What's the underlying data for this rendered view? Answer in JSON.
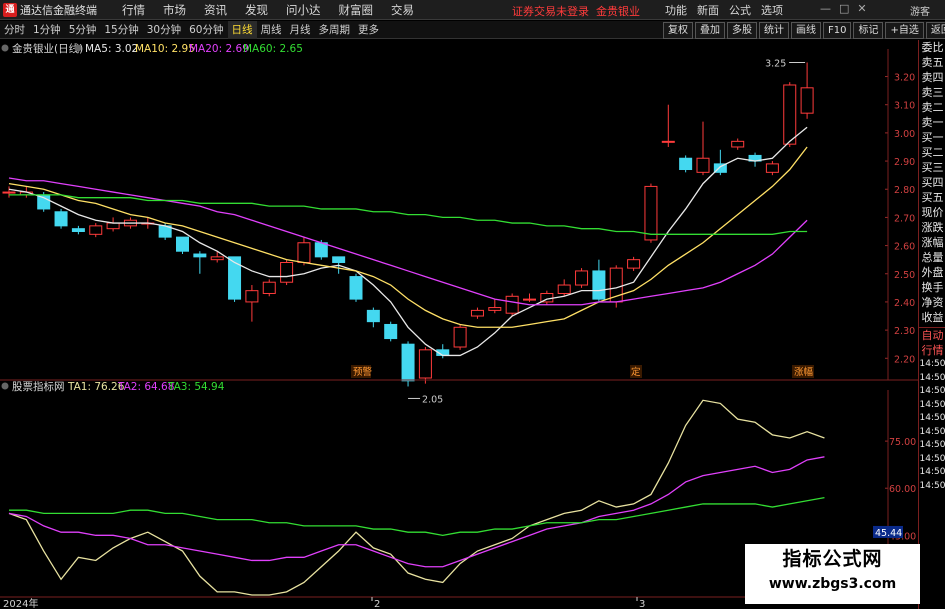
{
  "app": {
    "logo": "通",
    "title": "通达信金融终端",
    "menu": [
      "行情",
      "市场",
      "资讯",
      "发现",
      "问小达",
      "财富圈",
      "交易"
    ],
    "login_notice": "证券交易未登录",
    "login_stock": "金贵银业",
    "right_menu": [
      "功能",
      "新面",
      "公式",
      "选项"
    ],
    "guest": "游客"
  },
  "period_tabs": [
    {
      "label": "分时",
      "active": false
    },
    {
      "label": "1分钟",
      "active": false
    },
    {
      "label": "5分钟",
      "active": false
    },
    {
      "label": "15分钟",
      "active": false
    },
    {
      "label": "30分钟",
      "active": false
    },
    {
      "label": "60分钟",
      "active": false
    },
    {
      "label": "日线",
      "active": true
    },
    {
      "label": "周线",
      "active": false
    },
    {
      "label": "月线",
      "active": false
    },
    {
      "label": "多周期",
      "active": false
    },
    {
      "label": "更多",
      "active": false
    }
  ],
  "right_tools": [
    "复权",
    "叠加",
    "多股",
    "统计",
    "画线",
    "F10",
    "标记",
    "+自选",
    "返回"
  ],
  "price_panel": {
    "stock_label": "金贵银业(日线)",
    "indicators": [
      {
        "name": "MA5",
        "value": "3.02",
        "color": "#e8e8e8"
      },
      {
        "name": "MA10",
        "value": "2.95",
        "color": "#ffe066"
      },
      {
        "name": "MA20",
        "value": "2.69",
        "color": "#e040fb"
      },
      {
        "name": "MA60",
        "value": "2.65",
        "color": "#33dd33"
      }
    ],
    "y_ticks": [
      "3.20",
      "3.10",
      "3.00",
      "2.90",
      "2.80",
      "2.70",
      "2.60",
      "2.50",
      "2.40",
      "2.30",
      "2.20"
    ],
    "high_marker": "3.25",
    "low_marker": "2.05",
    "event_tags": [
      "预警",
      "定",
      "涨幅"
    ]
  },
  "indicator_panel": {
    "name": "股票指标网",
    "series": [
      {
        "name": "TA1",
        "value": "76.26",
        "color": "#e8e2a0"
      },
      {
        "name": "TA2",
        "value": "64.68",
        "color": "#e040fb"
      },
      {
        "name": "TA3",
        "value": "54.94",
        "color": "#33dd33"
      }
    ],
    "y_ticks": [
      "75.00",
      "60.00",
      "45.00",
      "30.00"
    ],
    "current_value": "45.44"
  },
  "x_axis": {
    "labels": [
      "2024年",
      "2",
      "3"
    ]
  },
  "right_panel": {
    "items": [
      "委比",
      "卖五",
      "卖四",
      "卖三",
      "卖二",
      "卖一",
      "买一",
      "买二",
      "买三",
      "买四",
      "买五",
      "现价",
      "涨跌",
      "涨幅",
      "总量",
      "外盘",
      "换手",
      "净资",
      "收益"
    ],
    "items2": [
      "自动",
      "行情"
    ],
    "times": [
      "14:50",
      "14:50",
      "14:50",
      "14:50",
      "14:50",
      "14:50",
      "14:50",
      "14:50",
      "14:50",
      "14:50"
    ]
  },
  "watermark": {
    "line1": "指标公式网",
    "line2": "www.zbgs3.com"
  },
  "chart_data": [
    {
      "type": "candlestick",
      "title": "金贵银业(日线)",
      "ylim": [
        2.13,
        3.28
      ],
      "y_ticks": [
        3.2,
        3.1,
        3.0,
        2.9,
        2.8,
        2.7,
        2.6,
        2.5,
        2.4,
        2.3,
        2.2
      ],
      "candles": [
        {
          "o": 2.79,
          "c": 2.79,
          "h": 2.81,
          "l": 2.77
        },
        {
          "o": 2.78,
          "c": 2.79,
          "h": 2.81,
          "l": 2.77
        },
        {
          "o": 2.78,
          "c": 2.73,
          "h": 2.79,
          "l": 2.72
        },
        {
          "o": 2.72,
          "c": 2.67,
          "h": 2.73,
          "l": 2.66
        },
        {
          "o": 2.66,
          "c": 2.65,
          "h": 2.67,
          "l": 2.64
        },
        {
          "o": 2.64,
          "c": 2.67,
          "h": 2.68,
          "l": 2.63
        },
        {
          "o": 2.66,
          "c": 2.68,
          "h": 2.7,
          "l": 2.65
        },
        {
          "o": 2.67,
          "c": 2.69,
          "h": 2.7,
          "l": 2.66
        },
        {
          "o": 2.68,
          "c": 2.68,
          "h": 2.7,
          "l": 2.66
        },
        {
          "o": 2.67,
          "c": 2.63,
          "h": 2.68,
          "l": 2.62
        },
        {
          "o": 2.63,
          "c": 2.58,
          "h": 2.63,
          "l": 2.57
        },
        {
          "o": 2.57,
          "c": 2.56,
          "h": 2.58,
          "l": 2.5
        },
        {
          "o": 2.55,
          "c": 2.56,
          "h": 2.58,
          "l": 2.54
        },
        {
          "o": 2.56,
          "c": 2.41,
          "h": 2.56,
          "l": 2.4
        },
        {
          "o": 2.4,
          "c": 2.44,
          "h": 2.46,
          "l": 2.33
        },
        {
          "o": 2.43,
          "c": 2.47,
          "h": 2.48,
          "l": 2.42
        },
        {
          "o": 2.47,
          "c": 2.54,
          "h": 2.55,
          "l": 2.46
        },
        {
          "o": 2.54,
          "c": 2.61,
          "h": 2.63,
          "l": 2.53
        },
        {
          "o": 2.61,
          "c": 2.56,
          "h": 2.62,
          "l": 2.55
        },
        {
          "o": 2.56,
          "c": 2.54,
          "h": 2.56,
          "l": 2.5
        },
        {
          "o": 2.49,
          "c": 2.41,
          "h": 2.5,
          "l": 2.4
        },
        {
          "o": 2.37,
          "c": 2.33,
          "h": 2.38,
          "l": 2.31
        },
        {
          "o": 2.32,
          "c": 2.27,
          "h": 2.33,
          "l": 2.26
        },
        {
          "o": 2.25,
          "c": 2.12,
          "h": 2.26,
          "l": 2.1
        },
        {
          "o": 2.13,
          "c": 2.23,
          "h": 2.24,
          "l": 2.11
        },
        {
          "o": 2.23,
          "c": 2.21,
          "h": 2.25,
          "l": 2.2
        },
        {
          "o": 2.24,
          "c": 2.31,
          "h": 2.32,
          "l": 2.23
        },
        {
          "o": 2.35,
          "c": 2.37,
          "h": 2.38,
          "l": 2.34
        },
        {
          "o": 2.37,
          "c": 2.38,
          "h": 2.41,
          "l": 2.36
        },
        {
          "o": 2.36,
          "c": 2.42,
          "h": 2.43,
          "l": 2.35
        },
        {
          "o": 2.41,
          "c": 2.41,
          "h": 2.43,
          "l": 2.4
        },
        {
          "o": 2.4,
          "c": 2.43,
          "h": 2.44,
          "l": 2.39
        },
        {
          "o": 2.43,
          "c": 2.46,
          "h": 2.48,
          "l": 2.42
        },
        {
          "o": 2.46,
          "c": 2.51,
          "h": 2.52,
          "l": 2.45
        },
        {
          "o": 2.51,
          "c": 2.41,
          "h": 2.55,
          "l": 2.4
        },
        {
          "o": 2.4,
          "c": 2.52,
          "h": 2.53,
          "l": 2.38
        },
        {
          "o": 2.52,
          "c": 2.55,
          "h": 2.56,
          "l": 2.51
        },
        {
          "o": 2.62,
          "c": 2.81,
          "h": 2.82,
          "l": 2.61
        },
        {
          "o": 2.97,
          "c": 2.97,
          "h": 3.1,
          "l": 2.95
        },
        {
          "o": 2.91,
          "c": 2.87,
          "h": 2.92,
          "l": 2.86
        },
        {
          "o": 2.86,
          "c": 2.91,
          "h": 3.04,
          "l": 2.85
        },
        {
          "o": 2.89,
          "c": 2.86,
          "h": 2.94,
          "l": 2.85
        },
        {
          "o": 2.95,
          "c": 2.97,
          "h": 2.98,
          "l": 2.94
        },
        {
          "o": 2.92,
          "c": 2.9,
          "h": 2.93,
          "l": 2.88
        },
        {
          "o": 2.86,
          "c": 2.89,
          "h": 2.9,
          "l": 2.85
        },
        {
          "o": 2.96,
          "c": 3.17,
          "h": 3.18,
          "l": 2.95
        },
        {
          "o": 3.07,
          "c": 3.16,
          "h": 3.25,
          "l": 3.05
        }
      ],
      "series": [
        {
          "name": "MA5",
          "color": "#e8e8e8",
          "values": [
            2.8,
            2.79,
            2.77,
            2.74,
            2.71,
            2.69,
            2.68,
            2.68,
            2.68,
            2.67,
            2.65,
            2.61,
            2.58,
            2.54,
            2.51,
            2.49,
            2.49,
            2.5,
            2.52,
            2.53,
            2.51,
            2.46,
            2.4,
            2.31,
            2.25,
            2.21,
            2.21,
            2.24,
            2.29,
            2.35,
            2.38,
            2.41,
            2.42,
            2.44,
            2.44,
            2.45,
            2.47,
            2.56,
            2.65,
            2.73,
            2.82,
            2.88,
            2.91,
            2.9,
            2.91,
            2.97,
            3.02
          ]
        },
        {
          "name": "MA10",
          "color": "#ffe066",
          "values": [
            2.82,
            2.81,
            2.8,
            2.78,
            2.76,
            2.75,
            2.73,
            2.71,
            2.7,
            2.68,
            2.67,
            2.65,
            2.63,
            2.61,
            2.59,
            2.57,
            2.55,
            2.54,
            2.53,
            2.52,
            2.51,
            2.49,
            2.46,
            2.41,
            2.37,
            2.34,
            2.32,
            2.31,
            2.31,
            2.31,
            2.32,
            2.33,
            2.34,
            2.37,
            2.4,
            2.42,
            2.44,
            2.48,
            2.53,
            2.57,
            2.61,
            2.66,
            2.71,
            2.76,
            2.81,
            2.87,
            2.95
          ]
        },
        {
          "name": "MA20",
          "color": "#e040fb",
          "values": [
            2.84,
            2.83,
            2.83,
            2.82,
            2.81,
            2.8,
            2.79,
            2.78,
            2.77,
            2.76,
            2.75,
            2.74,
            2.72,
            2.71,
            2.69,
            2.67,
            2.65,
            2.63,
            2.61,
            2.59,
            2.57,
            2.55,
            2.53,
            2.51,
            2.49,
            2.47,
            2.45,
            2.43,
            2.41,
            2.4,
            2.39,
            2.39,
            2.39,
            2.39,
            2.4,
            2.4,
            2.41,
            2.42,
            2.43,
            2.44,
            2.45,
            2.47,
            2.5,
            2.53,
            2.57,
            2.63,
            2.69
          ]
        },
        {
          "name": "MA60",
          "color": "#33dd33",
          "values": [
            2.78,
            2.78,
            2.78,
            2.78,
            2.77,
            2.77,
            2.77,
            2.77,
            2.76,
            2.76,
            2.76,
            2.75,
            2.75,
            2.75,
            2.75,
            2.74,
            2.74,
            2.74,
            2.73,
            2.73,
            2.73,
            2.72,
            2.72,
            2.71,
            2.71,
            2.7,
            2.7,
            2.69,
            2.69,
            2.68,
            2.68,
            2.67,
            2.67,
            2.66,
            2.66,
            2.65,
            2.65,
            2.64,
            2.64,
            2.64,
            2.64,
            2.64,
            2.64,
            2.64,
            2.64,
            2.65,
            2.65
          ]
        }
      ]
    },
    {
      "type": "line",
      "title": "股票指标网",
      "ylim": [
        26,
        90
      ],
      "y_ticks": [
        75,
        60,
        45,
        30
      ],
      "series": [
        {
          "name": "TA1",
          "color": "#e8e2a0",
          "values": [
            52,
            50,
            40,
            31,
            38,
            37,
            41,
            44,
            46,
            43,
            40,
            32,
            27,
            27,
            26,
            26,
            27,
            30,
            35,
            40,
            46,
            41,
            39,
            33,
            31,
            30,
            36,
            40,
            42,
            44,
            48,
            50,
            52,
            53,
            56,
            54,
            55,
            58,
            68,
            80,
            88,
            87,
            82,
            81,
            77,
            76,
            78,
            76
          ]
        },
        {
          "name": "TA2",
          "color": "#e040fb",
          "values": [
            52,
            51,
            48,
            46,
            46,
            45,
            45,
            44,
            42,
            42,
            41,
            40,
            39,
            38,
            37,
            37,
            38,
            38,
            40,
            42,
            42,
            40,
            38,
            36,
            35,
            35,
            37,
            39,
            41,
            43,
            45,
            47,
            48,
            49,
            51,
            52,
            53,
            55,
            58,
            62,
            64,
            65,
            66,
            67,
            65,
            66,
            69,
            70
          ]
        },
        {
          "name": "TA3",
          "color": "#33dd33",
          "values": [
            53,
            53,
            52,
            52,
            52,
            52,
            52,
            53,
            53,
            52,
            52,
            51,
            50,
            50,
            50,
            49,
            49,
            48,
            48,
            48,
            48,
            47,
            47,
            46,
            46,
            45,
            46,
            46,
            47,
            47,
            48,
            49,
            49,
            49,
            50,
            50,
            51,
            52,
            53,
            54,
            55,
            55,
            55,
            55,
            54,
            55,
            56,
            57
          ]
        }
      ]
    }
  ]
}
